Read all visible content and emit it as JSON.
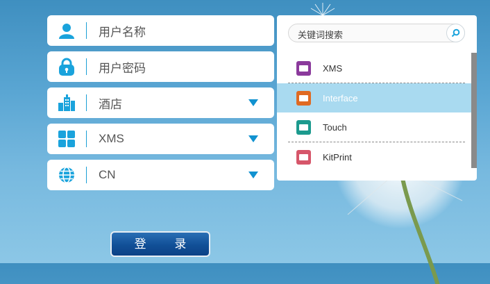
{
  "form": {
    "username_placeholder": "用户名称",
    "password_placeholder": "用户密码",
    "hotel_value": "酒店",
    "system_value": "XMS",
    "language_value": "CN",
    "login_label": "登 录"
  },
  "dropdown": {
    "search_placeholder": "关键词搜索",
    "items": [
      {
        "label": "XMS",
        "icon": "xms-app-icon",
        "color": "#8b3a9c",
        "selected": false
      },
      {
        "label": "Interface",
        "icon": "interface-app-icon",
        "color": "#e06a22",
        "selected": true
      },
      {
        "label": "Touch",
        "icon": "touch-app-icon",
        "color": "#1c9a8e",
        "selected": false
      },
      {
        "label": "KitPrint",
        "icon": "kitprint-app-icon",
        "color": "#d6566a",
        "selected": false
      }
    ]
  },
  "colors": {
    "accent": "#1192d0",
    "login_button": "#114f97",
    "selected_row": "#a9daf0"
  }
}
